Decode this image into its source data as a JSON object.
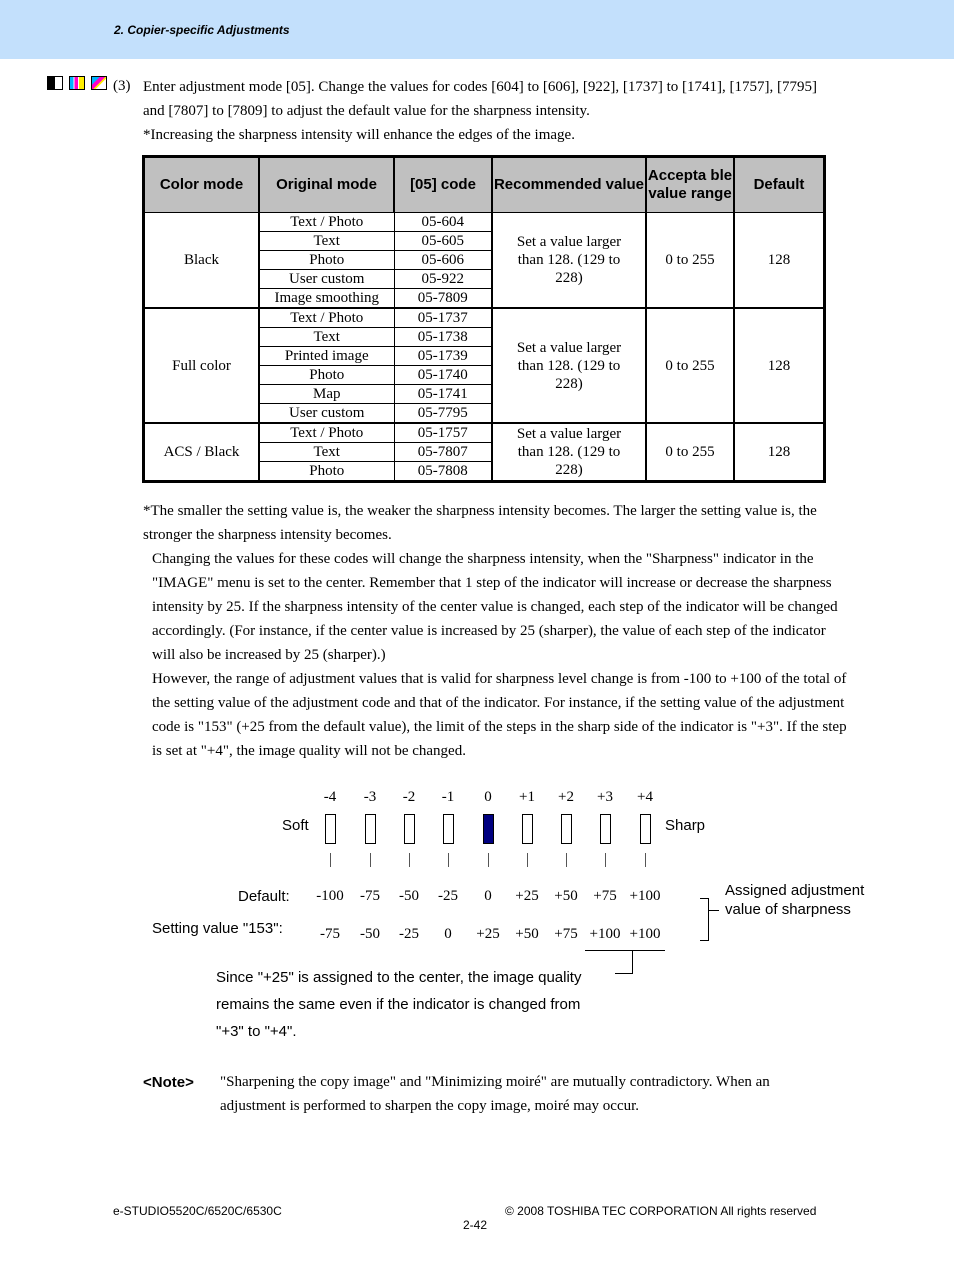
{
  "header": {
    "title": "2. Copier-specific Adjustments",
    "band_color": "#c3e0fc"
  },
  "intro": {
    "mode_icons": [
      "black-mode-icon",
      "full-color-mode-icon",
      "acs-mode-icon"
    ],
    "step_number": "(3)",
    "text": "Enter adjustment mode [05]. Change the values for codes [604] to [606], [922], [1737] to [1741], [1757], [7795] and [7807] to [7809] to adjust the default value for the sharpness intensity.",
    "bullet": "*Increasing the sharpness intensity will enhance the edges of the image."
  },
  "table": {
    "headers": [
      "Color mode",
      "Original mode",
      "[05] code",
      "Recommended value",
      "Accepta ble value range",
      "Default"
    ],
    "groups": [
      {
        "color_mode": "Black",
        "rows": [
          {
            "original_mode": "Text / Photo",
            "code": "05-604"
          },
          {
            "original_mode": "Text",
            "code": "05-605"
          },
          {
            "original_mode": "Photo",
            "code": "05-606"
          },
          {
            "original_mode": "User custom",
            "code": "05-922"
          },
          {
            "original_mode": "Image smoothing",
            "code": "05-7809"
          }
        ],
        "recommended": "Set a value larger than 128. (129 to 228)",
        "range": "0 to 255",
        "default": "128"
      },
      {
        "color_mode": "Full color",
        "rows": [
          {
            "original_mode": "Text / Photo",
            "code": "05-1737"
          },
          {
            "original_mode": "Text",
            "code": "05-1738"
          },
          {
            "original_mode": "Printed image",
            "code": "05-1739"
          },
          {
            "original_mode": "Photo",
            "code": "05-1740"
          },
          {
            "original_mode": "Map",
            "code": "05-1741"
          },
          {
            "original_mode": "User custom",
            "code": "05-7795"
          }
        ],
        "recommended": "Set a value larger than 128. (129 to 228)",
        "range": "0 to 255",
        "default": "128"
      },
      {
        "color_mode": "ACS / Black",
        "rows": [
          {
            "original_mode": "Text / Photo",
            "code": "05-1757"
          },
          {
            "original_mode": "Text",
            "code": "05-7807"
          },
          {
            "original_mode": "Photo",
            "code": "05-7808"
          }
        ],
        "recommended": "Set a value larger than 128. (129 to 228)",
        "range": "0 to 255",
        "default": "128"
      }
    ]
  },
  "notes": [
    "*The smaller the setting value is, the weaker the sharpness intensity becomes. The larger the setting value is, the stronger the sharpness intensity becomes.",
    "Changing the values for these codes will change the sharpness intensity, when the \"Sharpness\" indicator in the \"IMAGE\" menu is set to the center.  Remember that 1 step of the indicator will increase or decrease the sharpness intensity by 25.  If the sharpness intensity of the center value is changed, each step of the indicator will be changed accordingly.  (For instance, if the center value is increased by 25 (sharper), the value of each step of the indicator will also be increased by 25 (sharper).)",
    "However, the range of adjustment values that is valid for sharpness level change is from -100 to +100 of the total of the setting value of the adjustment code and that of the indicator. For instance, if the setting value of the adjustment code is \"153\" (+25 from the default value), the limit of the steps in the sharp side of the indicator is \"+3\". If the step is set at \"+4\", the image quality will not be changed."
  ],
  "diagram": {
    "soft_label": "Soft",
    "sharp_label": "Sharp",
    "steps": [
      "-4",
      "-3",
      "-2",
      "-1",
      "0",
      "+1",
      "+2",
      "+3",
      "+4"
    ],
    "active_step": "0",
    "active_color": "#000080",
    "default_label": "Default:",
    "default_values": [
      "-100",
      "-75",
      "-50",
      "-25",
      "0",
      "+25",
      "+50",
      "+75",
      "+100"
    ],
    "setting_label": "Setting value \"153\":",
    "setting_values": [
      "-75",
      "-50",
      "-25",
      "0",
      "+25",
      "+50",
      "+75",
      "+100",
      "+100"
    ],
    "bracket_label": "Assigned adjustment value of sharpness",
    "callout_lines": [
      "Since \"+25\" is assigned to the center, the image quality",
      "remains the same even if the indicator is changed from",
      "\"+3\" to \"+4\"."
    ]
  },
  "note": {
    "label": "<Note>",
    "text": "\"Sharpening the copy image\" and \"Minimizing moiré\" are mutually contradictory.  When an adjustment is performed to sharpen the copy image, moiré may occur."
  },
  "footer": {
    "model": "e-STUDIO5520C/6520C/6530C",
    "copyright": "© 2008 TOSHIBA TEC CORPORATION All rights reserved",
    "page": "2-42"
  }
}
